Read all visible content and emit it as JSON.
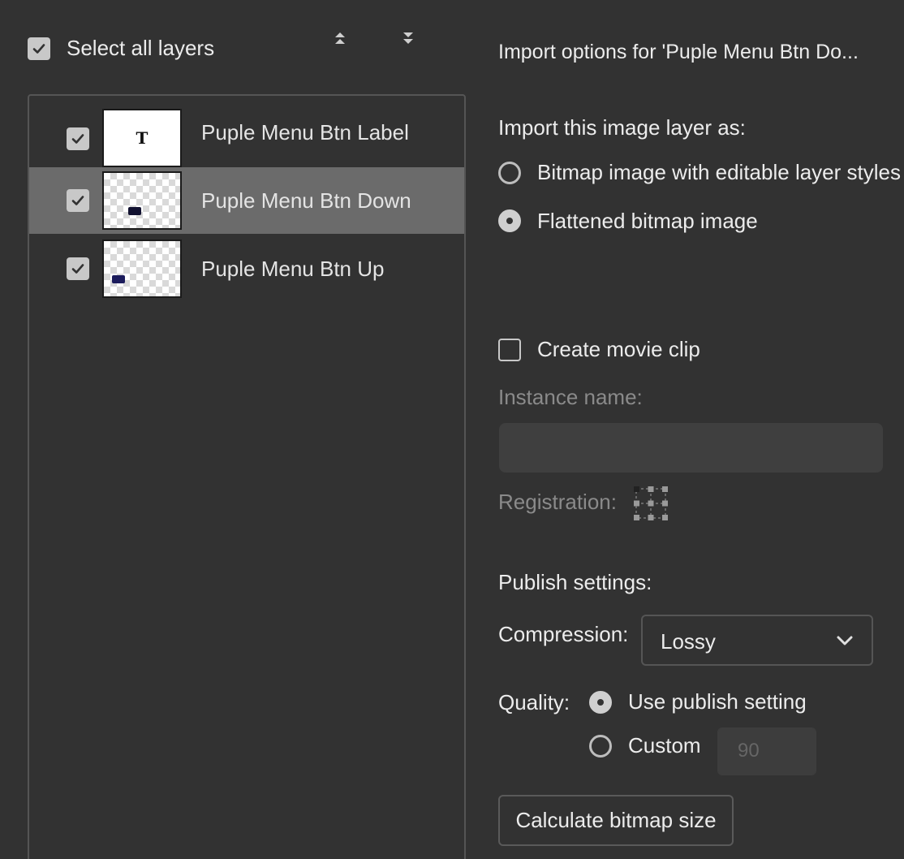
{
  "header": {
    "select_all_label": "Select all layers",
    "import_options_title": "Import options for 'Puple Menu Btn Do..."
  },
  "layers": [
    {
      "name": "Puple Menu Btn Label",
      "checked": true,
      "thumb": "T"
    },
    {
      "name": "Puple Menu Btn Down",
      "checked": true,
      "selected": true
    },
    {
      "name": "Puple Menu Btn Up",
      "checked": true
    }
  ],
  "import_as": {
    "heading": "Import this image layer as:",
    "option_editable": "Bitmap image with editable layer styles",
    "option_flattened": "Flattened bitmap image",
    "selected": "Flattened bitmap image"
  },
  "movie_clip": {
    "label": "Create movie clip",
    "checked": false,
    "instance_name_label": "Instance name:",
    "instance_name_value": "",
    "registration_label": "Registration:"
  },
  "publish": {
    "heading": "Publish settings:",
    "compression_label": "Compression:",
    "compression_value": "Lossy",
    "quality_label": "Quality:",
    "quality_option_publish": "Use publish setting",
    "quality_option_custom": "Custom",
    "quality_custom_value": "90",
    "calculate_button": "Calculate bitmap size"
  },
  "colors": {
    "background": "#323232",
    "selected_row": "#6b6b6b",
    "text": "#ececec",
    "dim_text": "#8a8a8a"
  }
}
